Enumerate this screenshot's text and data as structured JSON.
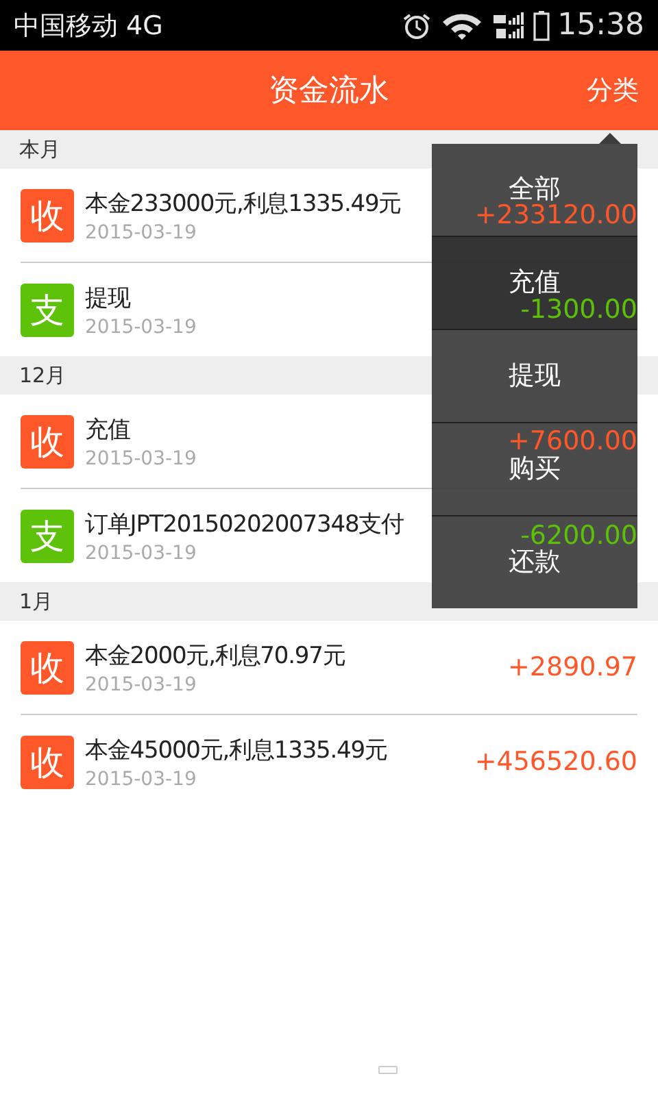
{
  "status_bar": {
    "carrier": "中国移动 4G",
    "time": "15:38"
  },
  "header": {
    "title": "资金流水",
    "action": "分类"
  },
  "sections": [
    {
      "label": "本月",
      "rows": [
        {
          "kind": "income",
          "badge": "收",
          "title": "本金233000元,利息1335.49元",
          "date": "2015-03-19",
          "amount": "+233120.00"
        },
        {
          "kind": "expense",
          "badge": "支",
          "title": "提现",
          "date": "2015-03-19",
          "amount": "-1300.00"
        }
      ]
    },
    {
      "label": "12月",
      "rows": [
        {
          "kind": "income",
          "badge": "收",
          "title": "充值",
          "date": "2015-03-19",
          "amount": "+7600.00"
        },
        {
          "kind": "expense",
          "badge": "支",
          "title": "订单JPT20150202007348支付",
          "date": "2015-03-19",
          "amount": "-6200.00"
        }
      ]
    },
    {
      "label": "1月",
      "rows": [
        {
          "kind": "income",
          "badge": "收",
          "title": "本金2000元,利息70.97元",
          "date": "2015-03-19",
          "amount": "+2890.97"
        },
        {
          "kind": "income",
          "badge": "收",
          "title": "本金45000元,利息1335.49元",
          "date": "2015-03-19",
          "amount": "+456520.60"
        }
      ]
    }
  ],
  "menu": [
    {
      "label": "全部",
      "selected": false
    },
    {
      "label": "充值",
      "selected": true
    },
    {
      "label": "提现",
      "selected": false
    },
    {
      "label": "购买",
      "selected": false
    },
    {
      "label": "还款",
      "selected": false
    }
  ]
}
